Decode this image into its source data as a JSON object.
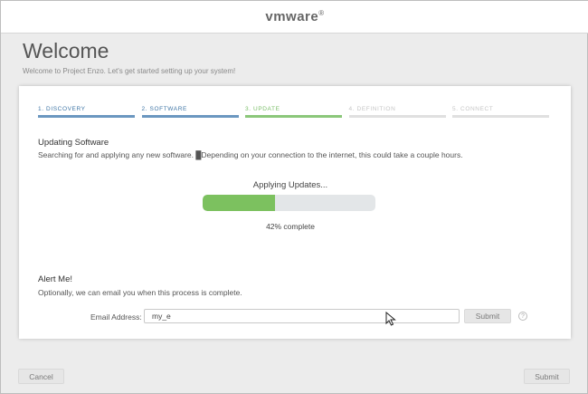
{
  "header": {
    "logo": "vmware",
    "logo_sup": "®"
  },
  "page": {
    "title": "Welcome",
    "subtitle": "Welcome to Project Enzo. Let's get started setting up your system!"
  },
  "steps": [
    {
      "label": "1. DISCOVERY",
      "state": "done"
    },
    {
      "label": "2. SOFTWARE",
      "state": "done"
    },
    {
      "label": "3. UPDATE",
      "state": "active"
    },
    {
      "label": "4. DEFINITION",
      "state": "pending"
    },
    {
      "label": "5. CONNECT",
      "state": "pending"
    }
  ],
  "updating": {
    "title": "Updating Software",
    "text": "Searching for and applying any new software. █Depending on your connection to the internet, this could take a couple hours."
  },
  "progress": {
    "heading": "Applying Updates...",
    "percent": 42,
    "caption": "42% complete"
  },
  "alert": {
    "title": "Alert Me!",
    "text": "Optionally, we can email you when this process is complete.",
    "email_label": "Email Address:",
    "email_value": "my_e",
    "submit_label": "Submit",
    "help_glyph": "?"
  },
  "footer": {
    "cancel_label": "Cancel",
    "submit_label": "Submit"
  },
  "colors": {
    "done": "#6b97c0",
    "active": "#8bc77a",
    "pending": "#e0e0e0",
    "progress_fill": "#7cc15f"
  },
  "icons": {
    "help": "help-icon",
    "cursor": "mouse-cursor-icon"
  }
}
